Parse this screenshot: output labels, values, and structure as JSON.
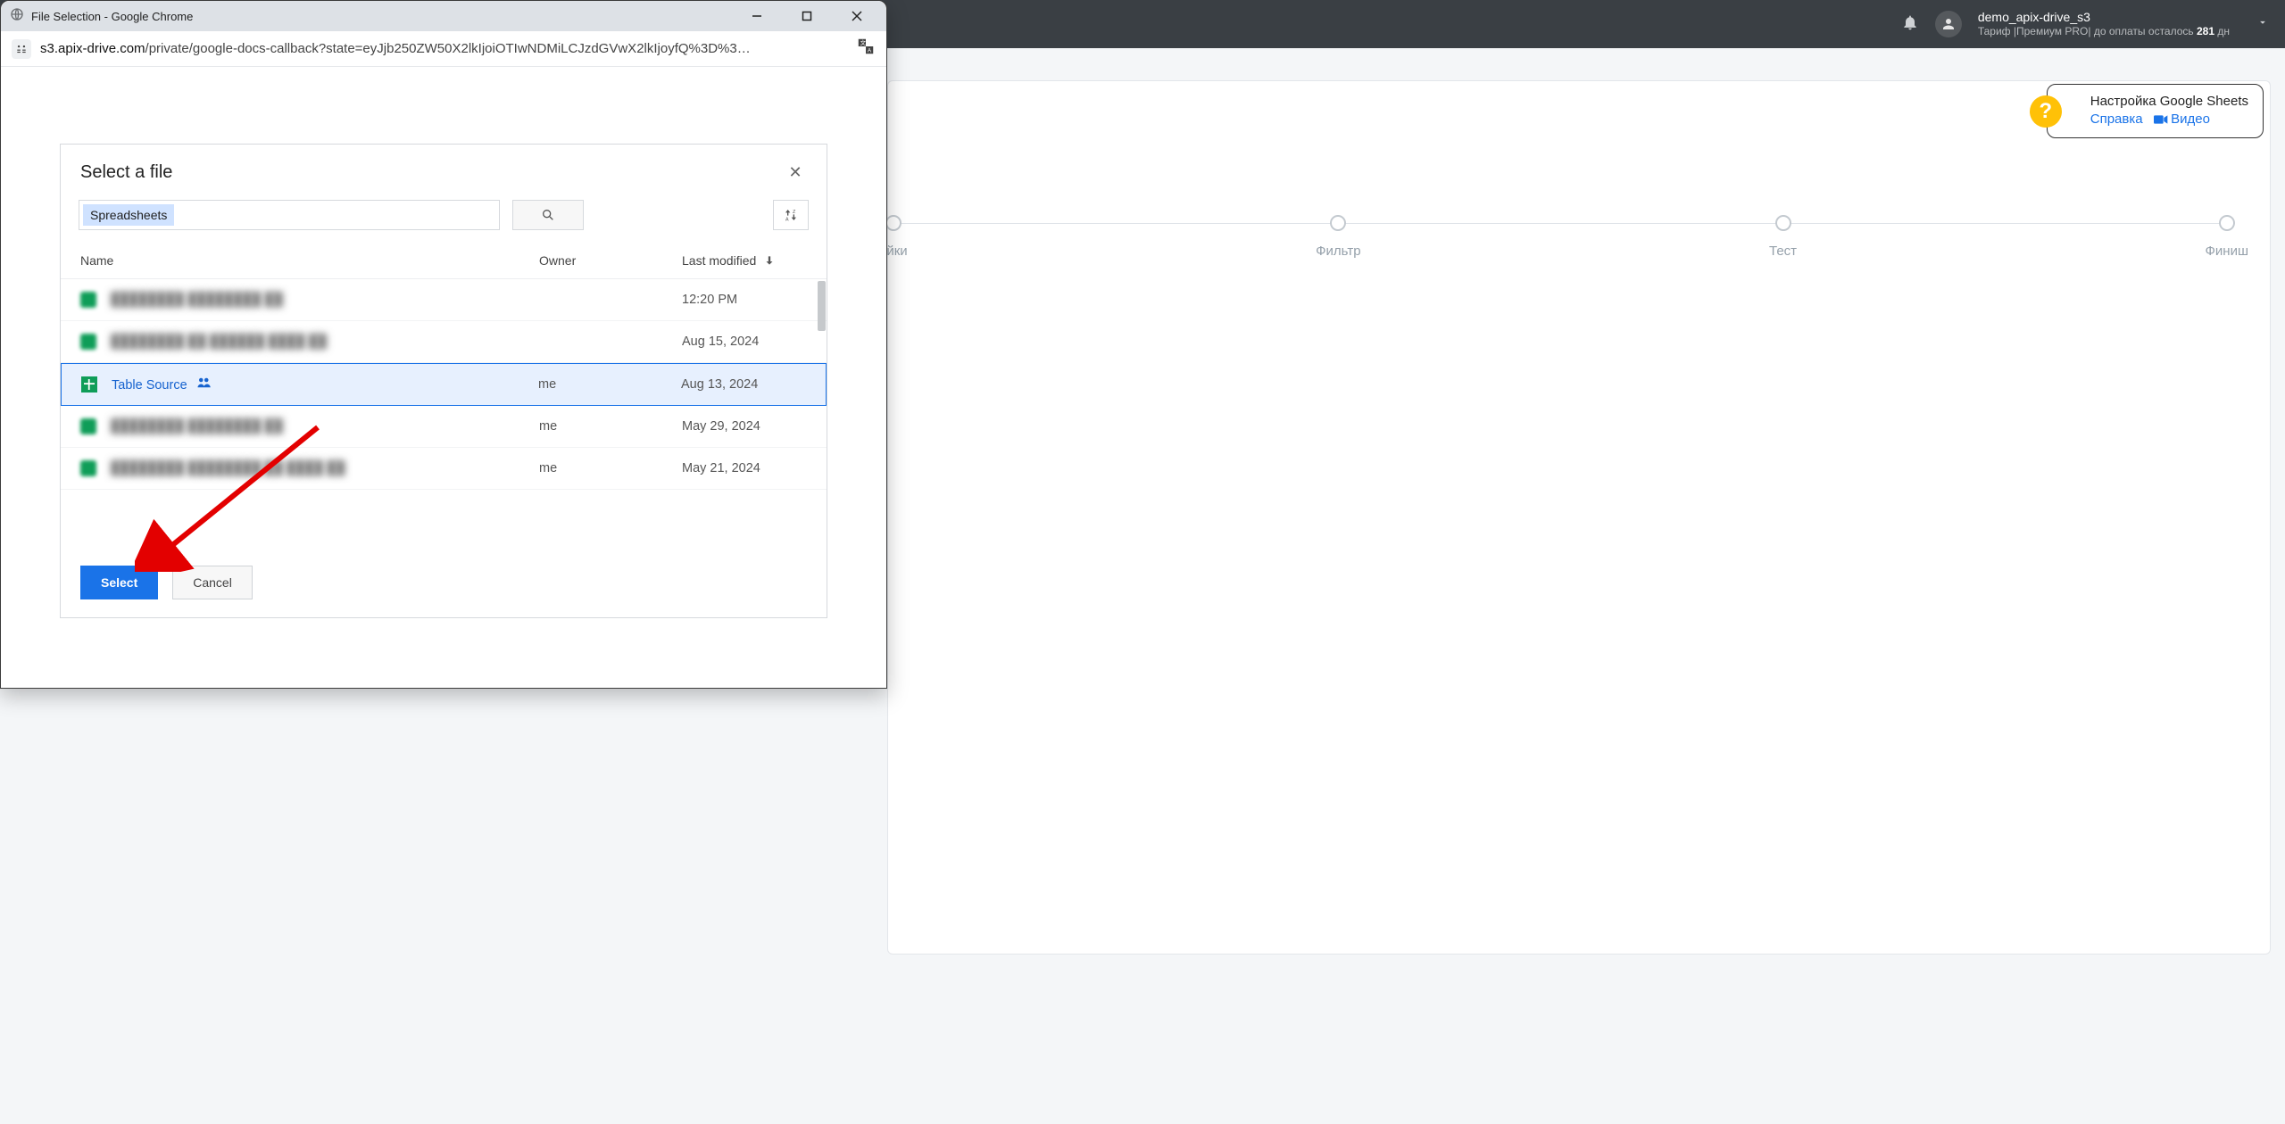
{
  "app_nav": {
    "user_name": "demo_apix-drive_s3",
    "tariff_prefix": "Тариф |",
    "tariff_name": "Премиум PRO",
    "pay_prefix": "| до оплаты осталось ",
    "pay_days": "281",
    "pay_suffix": " дн"
  },
  "steps": {
    "items": [
      {
        "label": "ойки"
      },
      {
        "label": "Фильтр"
      },
      {
        "label": "Тест"
      },
      {
        "label": "Финиш"
      }
    ]
  },
  "help": {
    "title": "Настройка Google Sheets",
    "link1": "Справка",
    "link2": "Видео"
  },
  "chrome": {
    "title": "File Selection - Google Chrome",
    "url_host": "s3.apix-drive.com",
    "url_path": "/private/google-docs-callback?state=eyJjb250ZW50X2lkIjoiOTIwNDMiLCJzdGVwX2lkIjoyfQ%3D%3…"
  },
  "picker": {
    "title": "Select a file",
    "chip": "Spreadsheets",
    "col_name": "Name",
    "col_owner": "Owner",
    "col_date": "Last modified",
    "rows": [
      {
        "name": "████████ ████████ ██",
        "owner": "",
        "date": "12:20 PM",
        "blurred": true
      },
      {
        "name": "████████ ██ ██████ ████ ██",
        "owner": "",
        "date": "Aug 15, 2024",
        "blurred": true
      },
      {
        "name": "Table Source",
        "owner": "me",
        "date": "Aug 13, 2024",
        "blurred": false,
        "selected": true,
        "shared": true
      },
      {
        "name": "████████ ████████ ██",
        "owner": "me",
        "date": "May 29, 2024",
        "blurred": true
      },
      {
        "name": "████████ ████████ ██ ████ ██",
        "owner": "me",
        "date": "May 21, 2024",
        "blurred": true
      }
    ],
    "select_label": "Select",
    "cancel_label": "Cancel"
  }
}
